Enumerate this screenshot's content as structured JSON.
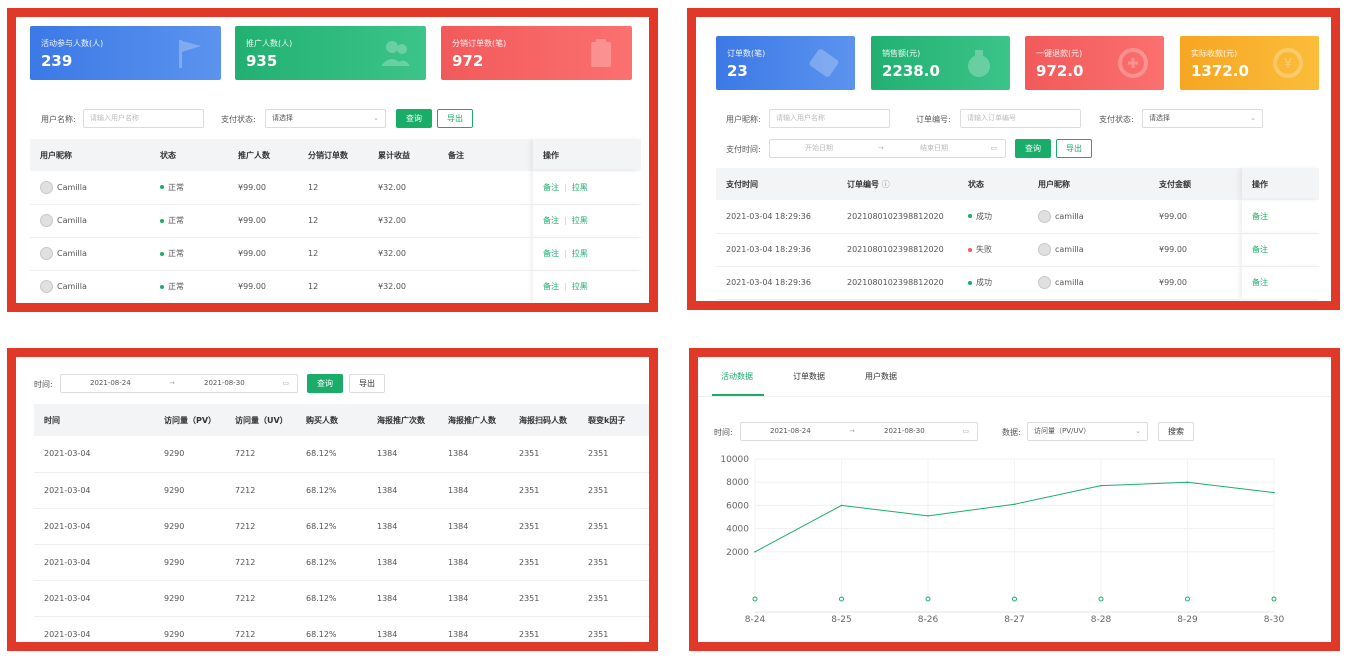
{
  "panel1": {
    "cards": [
      {
        "label": "活动参与人数(人)",
        "value": "239",
        "color": "blue",
        "icon": "flag-icon"
      },
      {
        "label": "推广人数(人)",
        "value": "935",
        "color": "green",
        "icon": "users-icon"
      },
      {
        "label": "分销订单数(笔)",
        "value": "972",
        "color": "red",
        "icon": "clipboard-icon"
      }
    ],
    "filters": {
      "nickname_label": "用户名称:",
      "nickname_placeholder": "请输入用户名称",
      "pay_status_label": "支付状态:",
      "pay_status_value": "请选择",
      "query_label": "查询",
      "export_label": "导出"
    },
    "table": {
      "headers": [
        "用户昵称",
        "状态",
        "推广人数",
        "分销订单数",
        "累计收益",
        "备注",
        "操作"
      ],
      "rows": [
        {
          "name": "Camilla",
          "status": "正常",
          "promoters": "¥99.00",
          "orders": "12",
          "earnings": "¥32.00",
          "note": "",
          "act1": "备注",
          "act2": "拉黑"
        },
        {
          "name": "Camilla",
          "status": "正常",
          "promoters": "¥99.00",
          "orders": "12",
          "earnings": "¥32.00",
          "note": "",
          "act1": "备注",
          "act2": "拉黑"
        },
        {
          "name": "Camilla",
          "status": "正常",
          "promoters": "¥99.00",
          "orders": "12",
          "earnings": "¥32.00",
          "note": "",
          "act1": "备注",
          "act2": "拉黑"
        },
        {
          "name": "Camilla",
          "status": "正常",
          "promoters": "¥99.00",
          "orders": "12",
          "earnings": "¥32.00",
          "note": "",
          "act1": "备注",
          "act2": "拉黑"
        }
      ]
    }
  },
  "panel2": {
    "cards": [
      {
        "label": "订单数(笔)",
        "value": "23",
        "color": "blue",
        "icon": "ticket-icon"
      },
      {
        "label": "销售额(元)",
        "value": "2238.0",
        "color": "green",
        "icon": "money-bag-icon"
      },
      {
        "label": "一键退款(元)",
        "value": "972.0",
        "color": "red",
        "icon": "refund-icon"
      },
      {
        "label": "实际收款(元)",
        "value": "1372.0",
        "color": "orange",
        "icon": "wallet-icon"
      }
    ],
    "filters": {
      "nickname_label": "用户昵称:",
      "nickname_placeholder": "请输入用户名称",
      "order_no_label": "订单编号:",
      "order_no_placeholder": "请输入订单编号",
      "pay_status_label": "支付状态:",
      "pay_status_value": "请选择",
      "pay_time_label": "支付时间:",
      "start_placeholder": "开始日期",
      "end_placeholder": "结束日期",
      "range_sep": "→",
      "query_label": "查询",
      "export_label": "导出"
    },
    "table": {
      "headers": [
        "支付时间",
        "订单编号",
        "状态",
        "用户昵称",
        "支付金额",
        "操作"
      ],
      "rows": [
        {
          "time": "2021-03-04 18:29:36",
          "order": "2021080102398812020",
          "status": "成功",
          "status_color": "#1aad6a",
          "user": "camilla",
          "amount": "¥99.00",
          "act": "备注"
        },
        {
          "time": "2021-03-04 18:29:36",
          "order": "2021080102398812020",
          "status": "失败",
          "status_color": "#f25a5a",
          "user": "camilla",
          "amount": "¥99.00",
          "act": "备注"
        },
        {
          "time": "2021-03-04 18:29:36",
          "order": "2021080102398812020",
          "status": "成功",
          "status_color": "#1aad6a",
          "user": "camilla",
          "amount": "¥99.00",
          "act": "备注"
        }
      ]
    }
  },
  "panel3": {
    "filters": {
      "time_label": "时间:",
      "start_date": "2021-08-24",
      "end_date": "2021-08-30",
      "range_sep": "→",
      "query_label": "查询",
      "export_label": "导出"
    },
    "table": {
      "headers": [
        "时间",
        "访问量（PV）",
        "访问量（UV）",
        "购买人数",
        "海报推广次数",
        "海报推广人数",
        "海报扫码人数",
        "裂变k因子"
      ],
      "rows": [
        [
          "2021-03-04",
          "9290",
          "7212",
          "68.12%",
          "1384",
          "1384",
          "2351",
          "2351"
        ],
        [
          "2021-03-04",
          "9290",
          "7212",
          "68.12%",
          "1384",
          "1384",
          "2351",
          "2351"
        ],
        [
          "2021-03-04",
          "9290",
          "7212",
          "68.12%",
          "1384",
          "1384",
          "2351",
          "2351"
        ],
        [
          "2021-03-04",
          "9290",
          "7212",
          "68.12%",
          "1384",
          "1384",
          "2351",
          "2351"
        ],
        [
          "2021-03-04",
          "9290",
          "7212",
          "68.12%",
          "1384",
          "1384",
          "2351",
          "2351"
        ],
        [
          "2021-03-04",
          "9290",
          "7212",
          "68.12%",
          "1384",
          "1384",
          "2351",
          "2351"
        ]
      ]
    }
  },
  "panel4": {
    "tabs": [
      "活动数据",
      "订单数据",
      "用户数据"
    ],
    "active_tab": 0,
    "filters": {
      "time_label": "时间:",
      "start_date": "2021-08-24",
      "end_date": "2021-08-30",
      "range_sep": "→",
      "data_label": "数据:",
      "data_value": "访问量（PV/UV）",
      "search_label": "搜索"
    }
  },
  "chart_data": {
    "type": "line",
    "categories": [
      "8-24",
      "8-25",
      "8-26",
      "8-27",
      "8-28",
      "8-29",
      "8-30"
    ],
    "series": [
      {
        "values": [
          2000,
          6000,
          5100,
          6100,
          7700,
          8000,
          7100
        ],
        "color": "#1aad6a"
      }
    ],
    "ylim": [
      0,
      10000
    ],
    "yticks": [
      "10000",
      "8000",
      "6000",
      "4000",
      "2000"
    ],
    "grid": true
  },
  "colors": {
    "accent": "#1aad6a",
    "frame": "#e0392a"
  }
}
